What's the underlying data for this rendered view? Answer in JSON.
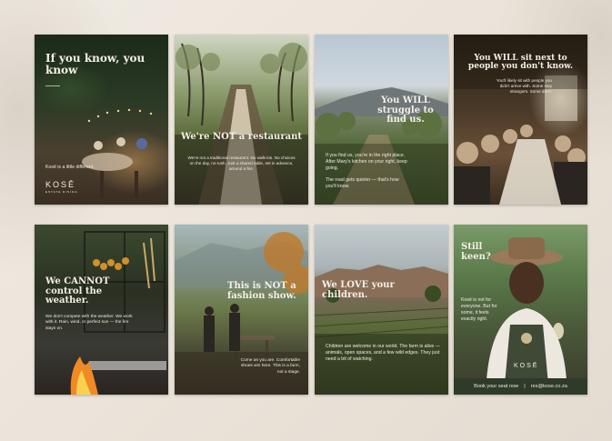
{
  "cards": [
    {
      "headline": "If you know, you know",
      "body": "Kosē is a little different.",
      "logo": "KOSĒ",
      "logo_sub": "ESTATE DINING"
    },
    {
      "headline": "We're NOT a restaurant",
      "body": "We're not a traditional restaurant. No walk-ins. No choices on the day, no rush. Just a shared table, set in advance, around a fire."
    },
    {
      "headline": "You WILL struggle to find us.",
      "body": "If you find us, you're in the right place. After Mary's kitchen on your right, keep going.",
      "body2": "The road gets quieter — that's how you'll know."
    },
    {
      "headline": "You WILL sit next to people you don't know.",
      "body": "You'll likely sit with people you didn't arrive with. Some stay strangers. Some don't."
    },
    {
      "headline": "We CANNOT control the weather.",
      "body": "We don't compete with the weather. We work with it. Rain, wind, or perfect sun — the fire stays on."
    },
    {
      "headline": "This is NOT a fashion show.",
      "body": "Come as you are. Comfortable shoes win here. This is a farm, not a stage."
    },
    {
      "headline": "We LOVE your children.",
      "body": "Children are welcome in our world. The farm is alive — animals, open spaces, and a few wild edges. They just need a bit of watching."
    },
    {
      "headline": "Still keen?",
      "body": "Kosē is not for everyone. But for some, it feels exactly right.",
      "logo": "KOSĒ",
      "cta": "Book your seat now",
      "email": "res@kose.co.za"
    }
  ],
  "colors": {
    "background": "#ebe4da",
    "text_light": "#f3efe6",
    "strip": "#2f3b2a"
  }
}
